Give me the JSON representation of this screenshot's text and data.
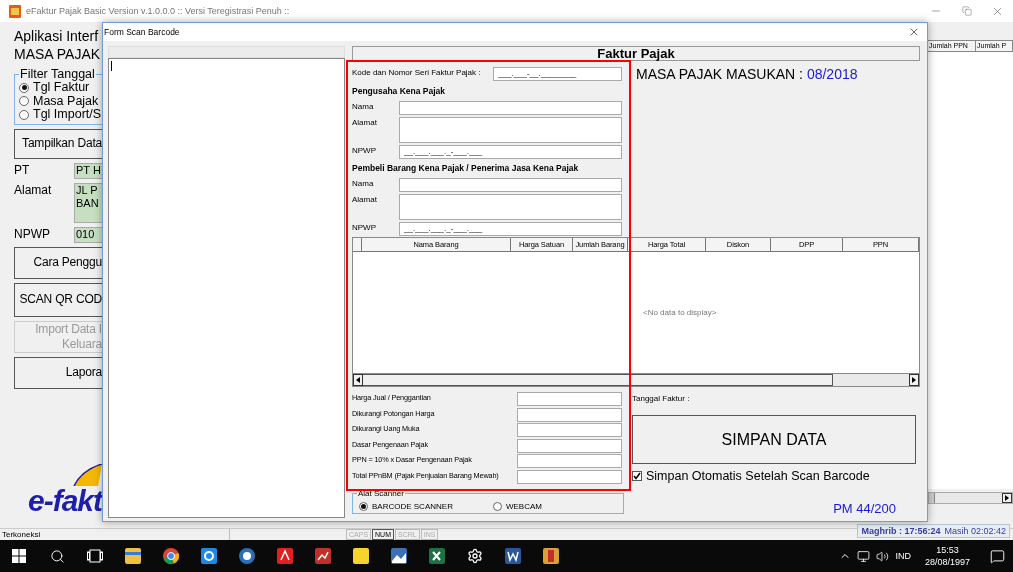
{
  "main_window": {
    "title": "eFaktur Pajak Basic Version v.1.0.0.0 :: Versi Teregistrasi Penuh ::",
    "app_heading": "Aplikasi Interf",
    "period_heading": "MASA PAJAK",
    "filter": {
      "legend": "Filter Tanggal",
      "options": [
        {
          "label": "Tgl Faktur",
          "selected": true
        },
        {
          "label": "Masa Pajak",
          "selected": false
        },
        {
          "label": "Tgl Import/S",
          "selected": false
        }
      ]
    },
    "show_button": "Tampilkan Data",
    "company": [
      {
        "label": "PT",
        "value": "PT H",
        "kind": "line"
      },
      {
        "label": "Alamat",
        "value": "JL P\nBAN",
        "kind": "area"
      },
      {
        "label": "NPWP",
        "value": "010",
        "kind": "line"
      }
    ],
    "menu_buttons": [
      {
        "label": "Cara Penggu",
        "disabled": false
      },
      {
        "label": "SCAN QR COD",
        "disabled": false
      },
      {
        "label": "Import Data I\nKeluara",
        "disabled": true
      },
      {
        "label": "Lapora",
        "disabled": false
      }
    ],
    "logo": "e-fakt",
    "table_columns": [
      "Jumlah PPN",
      "Jumlah P"
    ],
    "status_bar": {
      "connection": "Terkoneksi",
      "keys": [
        {
          "label": "CAPS",
          "on": false
        },
        {
          "label": "NUM",
          "on": true
        },
        {
          "label": "SCRL",
          "on": false
        },
        {
          "label": "INS",
          "on": false
        }
      ],
      "prayer": "Maghrib : 17:56:24",
      "remaining": "Masih 02:02:42"
    }
  },
  "dialog": {
    "title": "Form Scan Barcode",
    "header": "Faktur Pajak",
    "serial": {
      "label": "Kode dan Nomor Seri Faktur Pajak :",
      "value": "___.___-__.________"
    },
    "seller": {
      "heading": "Pengusaha Kena Pajak",
      "fields": [
        {
          "label": "Nama",
          "kind": "line"
        },
        {
          "label": "Alamat",
          "kind": "area"
        },
        {
          "label": "NPWP",
          "kind": "line",
          "value": "__.___.___._-___.___"
        }
      ]
    },
    "buyer": {
      "heading": "Pembeli Barang Kena Pajak / Penerima Jasa Kena Pajak",
      "fields": [
        {
          "label": "Nama",
          "kind": "line"
        },
        {
          "label": "Alamat",
          "kind": "area"
        },
        {
          "label": "NPWP",
          "kind": "line",
          "value": "__.___.___._-___.___"
        }
      ]
    },
    "period": {
      "label": "MASA PAJAK MASUKAN :",
      "value": "08/2018"
    },
    "items_table": {
      "columns": [
        "Nama Barang",
        "Harga Satuan",
        "Jumlah Barang",
        "Harga Total",
        "Diskon",
        "DPP",
        "PPN"
      ],
      "empty_text": "<No data to display>"
    },
    "totals": [
      {
        "label": "Harga Jual / Penggantian"
      },
      {
        "label": "Dikurangi Potongan Harga"
      },
      {
        "label": "Dikurangi Uang Muka"
      },
      {
        "label": "Dasar Pengenaan Pajak"
      },
      {
        "label": "PPN = 10% x Dasar Pengenaan Pajak"
      },
      {
        "label": "Total PPnBM (Pajak Penjualan Barang Mewah)"
      }
    ],
    "scanner": {
      "legend": "Alat Scanner",
      "options": [
        {
          "label": "BARCODE SCANNER",
          "selected": true
        },
        {
          "label": "WEBCAM",
          "selected": false
        }
      ]
    },
    "invoice_date_label": "Tanggal Faktur :",
    "save_button": "SIMPAN DATA",
    "auto_save": {
      "label": "Simpan Otomatis Setelah Scan Barcode",
      "checked": true
    },
    "page_info": "PM 44/200"
  },
  "taskbar": {
    "language": "IND",
    "time": "15:53",
    "date": "28/08/1997"
  }
}
